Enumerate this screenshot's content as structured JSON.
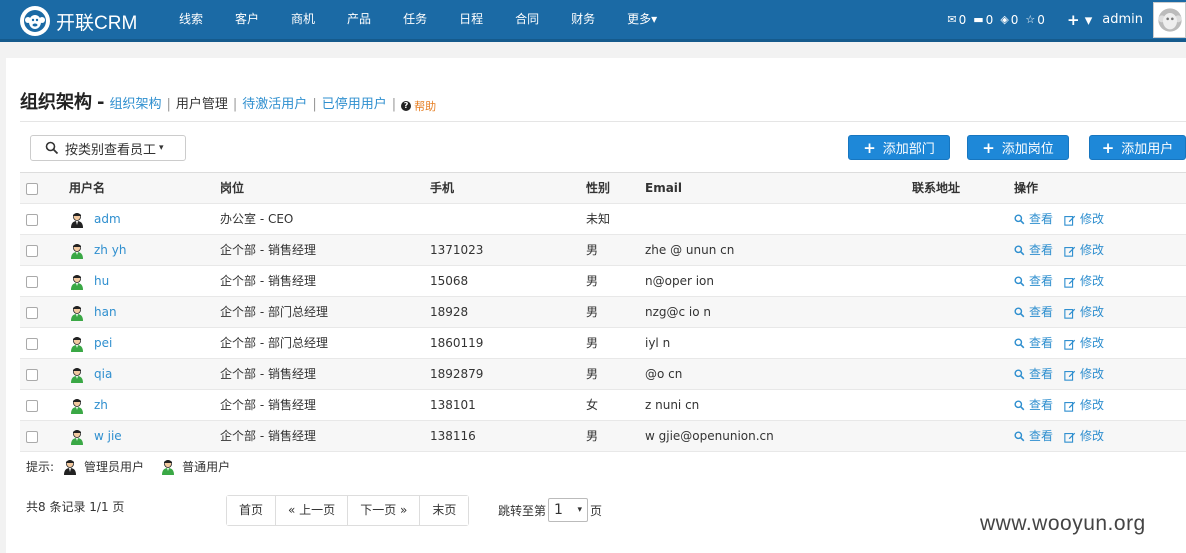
{
  "brand": {
    "name": "开联CRM"
  },
  "nav": {
    "items": [
      "线索",
      "客户",
      "商机",
      "产品",
      "任务",
      "日程",
      "合同",
      "财务",
      "更多"
    ],
    "more_caret": "▾",
    "stats": [
      {
        "icon": "envelope-icon",
        "glyph": "✉",
        "count": "0"
      },
      {
        "icon": "inbox-icon",
        "glyph": "▬",
        "count": "0"
      },
      {
        "icon": "share-icon",
        "glyph": "◈",
        "count": "0"
      },
      {
        "icon": "star-icon",
        "glyph": "☆",
        "count": "0"
      }
    ],
    "plus": "+ ▾",
    "user": "admin"
  },
  "page": {
    "title": "组织架构",
    "dash": "-",
    "crumbs": [
      "组织架构",
      "用户管理",
      "待激活用户",
      "已停用用户"
    ],
    "help_icon": "?",
    "help": "帮助"
  },
  "toolbar": {
    "filter_label": "按类别查看员工",
    "filter_caret": "▾",
    "add_department": "添加部门",
    "add_position": "添加岗位",
    "add_user": "添加用户"
  },
  "table": {
    "headers": {
      "username": "用户名",
      "position": "岗位",
      "phone": "手机",
      "gender": "性别",
      "email": "Email",
      "address": "联系地址",
      "actions": "操作"
    },
    "view_label": "查看",
    "edit_label": "修改",
    "rows": [
      {
        "user": "adm",
        "role": "admin",
        "position": "办公室 - CEO",
        "phone": "",
        "gender": "未知",
        "email": ""
      },
      {
        "user": "zh     yh",
        "role": "normal",
        "position": "企个部 - 销售经理",
        "phone": "1371023",
        "gender": "男",
        "email": "zhe     @     unun    cn"
      },
      {
        "user": "hu",
        "role": "normal",
        "position": "企个部 - 销售经理",
        "phone": "15068",
        "gender": "男",
        "email": "    n@oper    ion"
      },
      {
        "user": "han",
        "role": "normal",
        "position": "企个部 - 部门总经理",
        "phone": "18928",
        "gender": "男",
        "email": "  nzg@c      io      n"
      },
      {
        "user": "pei",
        "role": "normal",
        "position": "企个部 - 部门总经理",
        "phone": "1860119",
        "gender": "男",
        "email": "  iyl       n"
      },
      {
        "user": "qia",
        "role": "normal",
        "position": "企个部 - 销售经理",
        "phone": "1892879",
        "gender": "男",
        "email": "     @o        cn"
      },
      {
        "user": "zh",
        "role": "normal",
        "position": "企个部 - 销售经理",
        "phone": "138101",
        "gender": "女",
        "email": "z     nuni    cn"
      },
      {
        "user": "w    jie",
        "role": "normal",
        "position": "企个部 - 销售经理",
        "phone": "138116",
        "gender": "男",
        "email": "w    gjie@openunion.cn"
      }
    ]
  },
  "hint": {
    "label": "提示:",
    "admin_user": "管理员用户",
    "normal_user": "普通用户"
  },
  "pagination": {
    "count": "共8 条记录 1/1 页",
    "first": "首页",
    "prev": "« 上一页",
    "next": "下一页 »",
    "last": "末页",
    "jump_label": "跳转至第",
    "jump_value": "1",
    "jump_caret": "▾",
    "jump_suffix": "页"
  },
  "watermark": "www.wooyun.org",
  "colors": {
    "navbar": "#1b6aa5",
    "primary": "#1e88d8",
    "link": "#2f8fcf",
    "help": "#e67e22"
  }
}
